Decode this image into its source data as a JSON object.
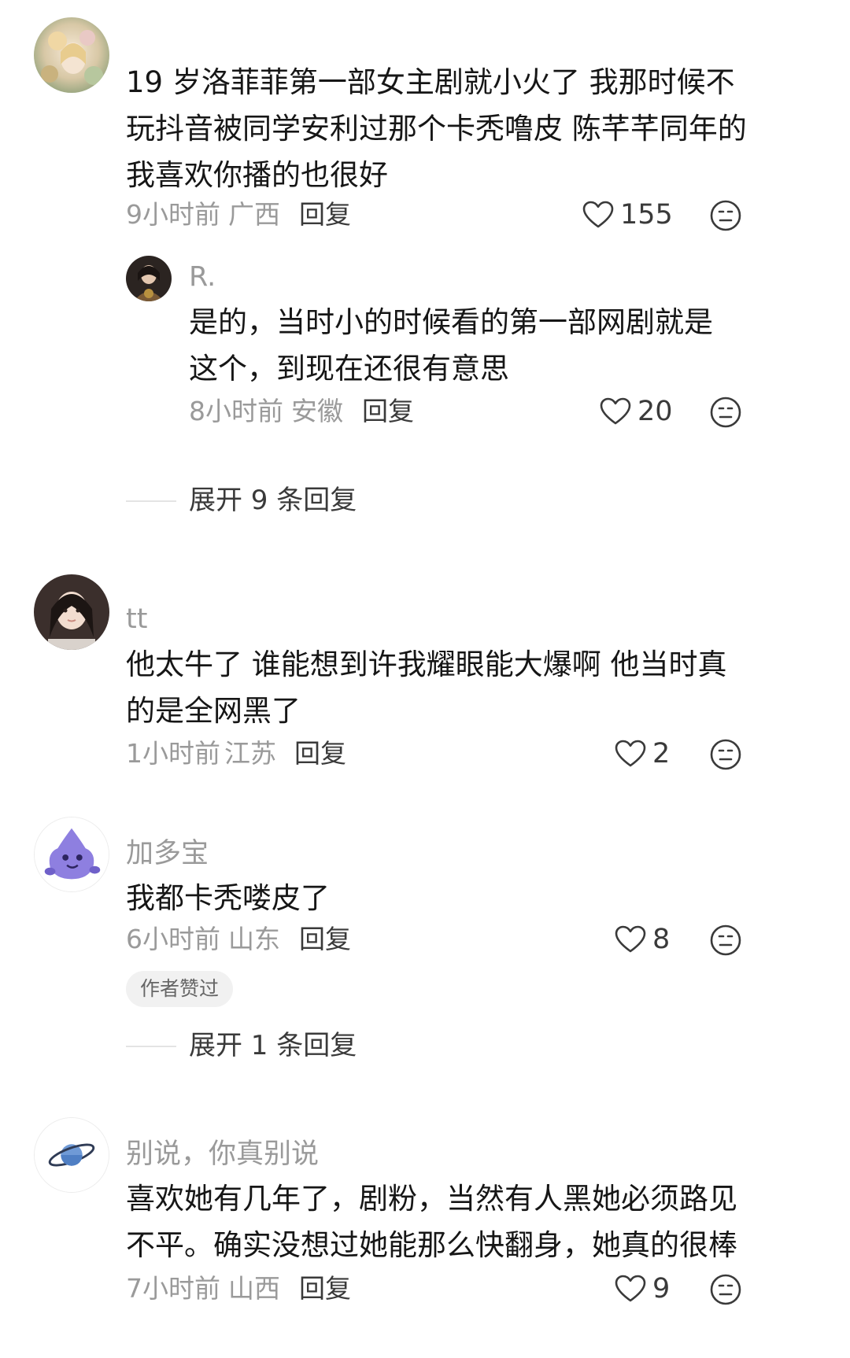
{
  "comments": [
    {
      "username": "",
      "text": "19 岁洛菲菲第一部女主剧就小火了 我那时候不玩抖音被同学安利过那个卡秃噜皮 陈芊芊同年的我喜欢你播的也很好",
      "time": "9小时前",
      "location": "广西",
      "reply_label": "回复",
      "likes": "155",
      "avatar": "floral-girl-avatar",
      "replies": [
        {
          "username": "R.",
          "text": "是的，当时小的时候看的第一部网剧就是这个，到现在还很有意思",
          "time": "8小时前",
          "location": "安徽",
          "reply_label": "回复",
          "likes": "20",
          "avatar": "dark-portrait-avatar"
        }
      ],
      "expand_label": "展开 9 条回复"
    },
    {
      "username": "tt",
      "text": "他太牛了 谁能想到许我耀眼能大爆啊 他当时真的是全网黑了",
      "time": "1小时前",
      "location": "江苏",
      "reply_label": "回复",
      "likes": "2",
      "avatar": "girl-portrait-avatar"
    },
    {
      "username": "加多宝",
      "text": "我都卡秃喽皮了",
      "time": "6小时前",
      "location": "山东",
      "reply_label": "回复",
      "likes": "8",
      "avatar": "purple-cartoon-avatar",
      "badge": "作者赞过",
      "expand_label": "展开 1 条回复"
    },
    {
      "username": "别说，你真别说",
      "text": "喜欢她有几年了，剧粉，当然有人黑她必须路见不平。确实没想过她能那么快翻身，她真的很棒",
      "time": "7小时前",
      "location": "山西",
      "reply_label": "回复",
      "likes": "9",
      "avatar": "planet-avatar"
    }
  ],
  "colors": {
    "text": "#161616",
    "meta": "#9a9a9a",
    "badge_bg": "#f1f1f1"
  }
}
